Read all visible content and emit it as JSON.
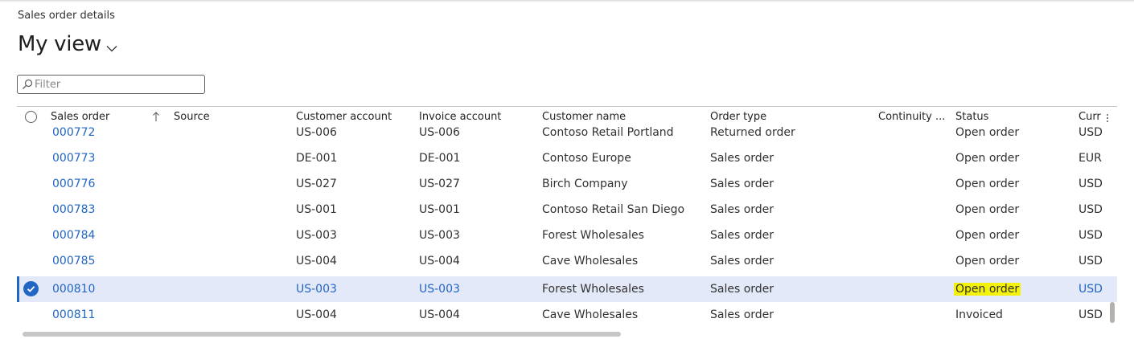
{
  "page": {
    "caption": "Sales order details",
    "view_title": "My view",
    "filter_placeholder": "Filter"
  },
  "grid": {
    "columns": [
      "Sales order",
      "Source",
      "Customer account",
      "Invoice account",
      "Customer name",
      "Order type",
      "Continuity ...",
      "Status",
      "Curr"
    ],
    "rows": [
      {
        "order": "000772",
        "account": "US-006",
        "invoice": "US-006",
        "name": "Contoso Retail Portland",
        "type": "Returned order",
        "status": "Open order",
        "curr": "USD"
      },
      {
        "order": "000773",
        "account": "DE-001",
        "invoice": "DE-001",
        "name": "Contoso Europe",
        "type": "Sales order",
        "status": "Open order",
        "curr": "EUR"
      },
      {
        "order": "000776",
        "account": "US-027",
        "invoice": "US-027",
        "name": "Birch Company",
        "type": "Sales order",
        "status": "Open order",
        "curr": "USD"
      },
      {
        "order": "000783",
        "account": "US-001",
        "invoice": "US-001",
        "name": "Contoso Retail San Diego",
        "type": "Sales order",
        "status": "Open order",
        "curr": "USD"
      },
      {
        "order": "000784",
        "account": "US-003",
        "invoice": "US-003",
        "name": "Forest Wholesales",
        "type": "Sales order",
        "status": "Open order",
        "curr": "USD"
      },
      {
        "order": "000785",
        "account": "US-004",
        "invoice": "US-004",
        "name": "Cave Wholesales",
        "type": "Sales order",
        "status": "Open order",
        "curr": "USD"
      },
      {
        "order": "000810",
        "account": "US-003",
        "invoice": "US-003",
        "name": "Forest Wholesales",
        "type": "Sales order",
        "status": "Open order",
        "curr": "USD"
      },
      {
        "order": "000811",
        "account": "US-004",
        "invoice": "US-004",
        "name": "Cave Wholesales",
        "type": "Sales order",
        "status": "Invoiced",
        "curr": "USD"
      }
    ]
  },
  "icons": {
    "sort": "arrow-up-icon",
    "filter": "search-icon",
    "chevron": "chevron-down-icon",
    "more": "more-vertical-icon",
    "check": "checkmark-circle-icon"
  },
  "colors": {
    "link": "#2266c4",
    "selected_row": "#e3e9f8",
    "highlight": "#f4f20a"
  }
}
